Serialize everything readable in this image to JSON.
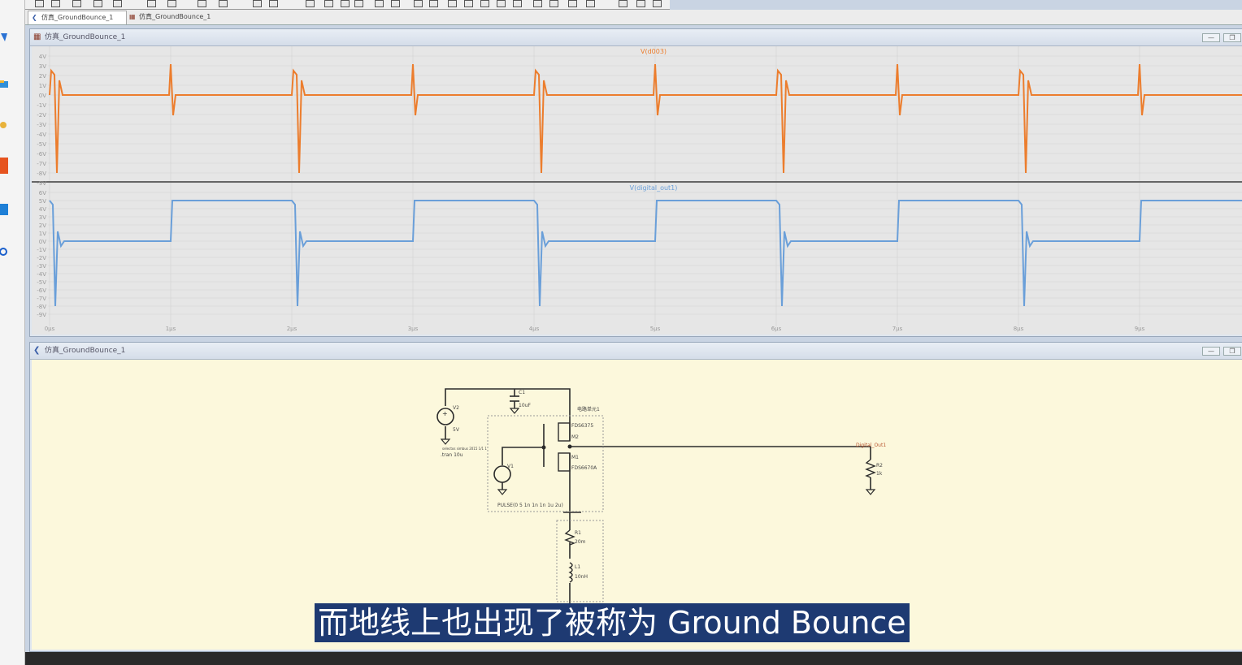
{
  "tabs": [
    "仿真_GroundBounce_1",
    "仿真_GroundBounce_1"
  ],
  "waveform_panel": {
    "title": "仿真_GroundBounce_1",
    "top_trace_label": "V(d003)",
    "bottom_trace_label": "V(digital_out1)",
    "top_y_ticks": [
      "4V",
      "3V",
      "2V",
      "1V",
      "0V",
      "-1V",
      "-2V",
      "-3V",
      "-4V",
      "-5V",
      "-6V",
      "-7V",
      "-8V",
      "-9V"
    ],
    "bottom_y_ticks": [
      "6V",
      "5V",
      "4V",
      "3V",
      "2V",
      "1V",
      "0V",
      "-1V",
      "-2V",
      "-3V",
      "-4V",
      "-5V",
      "-6V",
      "-7V",
      "-8V",
      "-9V"
    ],
    "x_ticks": [
      "0µs",
      "1µs",
      "2µs",
      "3µs",
      "4µs",
      "5µs",
      "6µs",
      "7µs",
      "8µs",
      "9µs"
    ]
  },
  "schematic_panel": {
    "title": "仿真_GroundBounce_1",
    "labels": {
      "v2": "V2",
      "v2_val": "5V",
      "c1": "C1",
      "c1_val": "10uF",
      "unit": "电路单元1",
      "fds6375": "FDS6375",
      "m2": "M2",
      "m1": "M1",
      "fds6670a": "FDS6670A",
      "v1": "V1",
      "pulse": "PULSE(0 5 1n 1n 1n 1u 2u)",
      "include_note": "selectos simbus 2015 1/1 1",
      "tran": ".tran 10u",
      "digital_out": "Digital_Out1",
      "r2": "R2",
      "r2_val": "1k",
      "r1": "R1",
      "r1_val": "20m",
      "l1": "L1",
      "l1_val": "10nH"
    }
  },
  "caption": "而地线上也出现了被称为 Ground Bounce",
  "colors": {
    "orange": "#ec7d2d",
    "blue": "#6a9fd9",
    "plot_bg": "#e6e6e6",
    "schem_bg": "#fcf8dc",
    "wire": "#2b2b2b",
    "caption_bg": "#1e3a72"
  }
}
